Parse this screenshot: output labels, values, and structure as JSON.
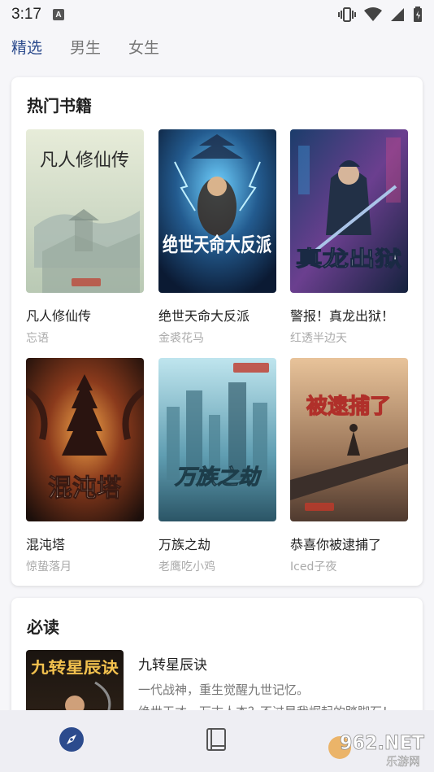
{
  "status": {
    "time": "3:17",
    "a_icon": "A"
  },
  "tabs": [
    {
      "label": "精选",
      "active": true
    },
    {
      "label": "男生",
      "active": false
    },
    {
      "label": "女生",
      "active": false
    }
  ],
  "hot": {
    "title": "热门书籍",
    "books": [
      {
        "title": "凡人修仙传",
        "author": "忘语",
        "cover_text": "凡人修仙传"
      },
      {
        "title": "绝世天命大反派",
        "author": "金裘花马",
        "cover_text": "绝世天命大反派"
      },
      {
        "title": "警报！真龙出狱！",
        "author": "红透半边天",
        "cover_text": "真龙出狱"
      },
      {
        "title": "混沌塔",
        "author": "惊蛰落月",
        "cover_text": "混沌塔"
      },
      {
        "title": "万族之劫",
        "author": "老鹰吃小鸡",
        "cover_text": "万族之劫"
      },
      {
        "title": "恭喜你被逮捕了",
        "author": "Iced子夜",
        "cover_text": "被逮捕了"
      }
    ]
  },
  "must_read": {
    "title": "必读",
    "book": {
      "title": "九转星辰诀",
      "cover_text": "九转星辰诀",
      "desc_lines": [
        "一代战神，重生觉醒九世记忆。",
        "绝世天才，万古人杰？不过是我崛起的踏脚石！"
      ]
    }
  },
  "nav": [
    {
      "name": "discover",
      "icon": "compass-icon",
      "active": true
    },
    {
      "name": "bookshelf",
      "icon": "book-icon",
      "active": false
    }
  ],
  "watermark": {
    "text": "962.NET",
    "sub": "乐游网"
  },
  "colors": {
    "accent": "#2c4b8d",
    "card_bg": "#ffffff",
    "page_bg": "#f6f6f9"
  }
}
